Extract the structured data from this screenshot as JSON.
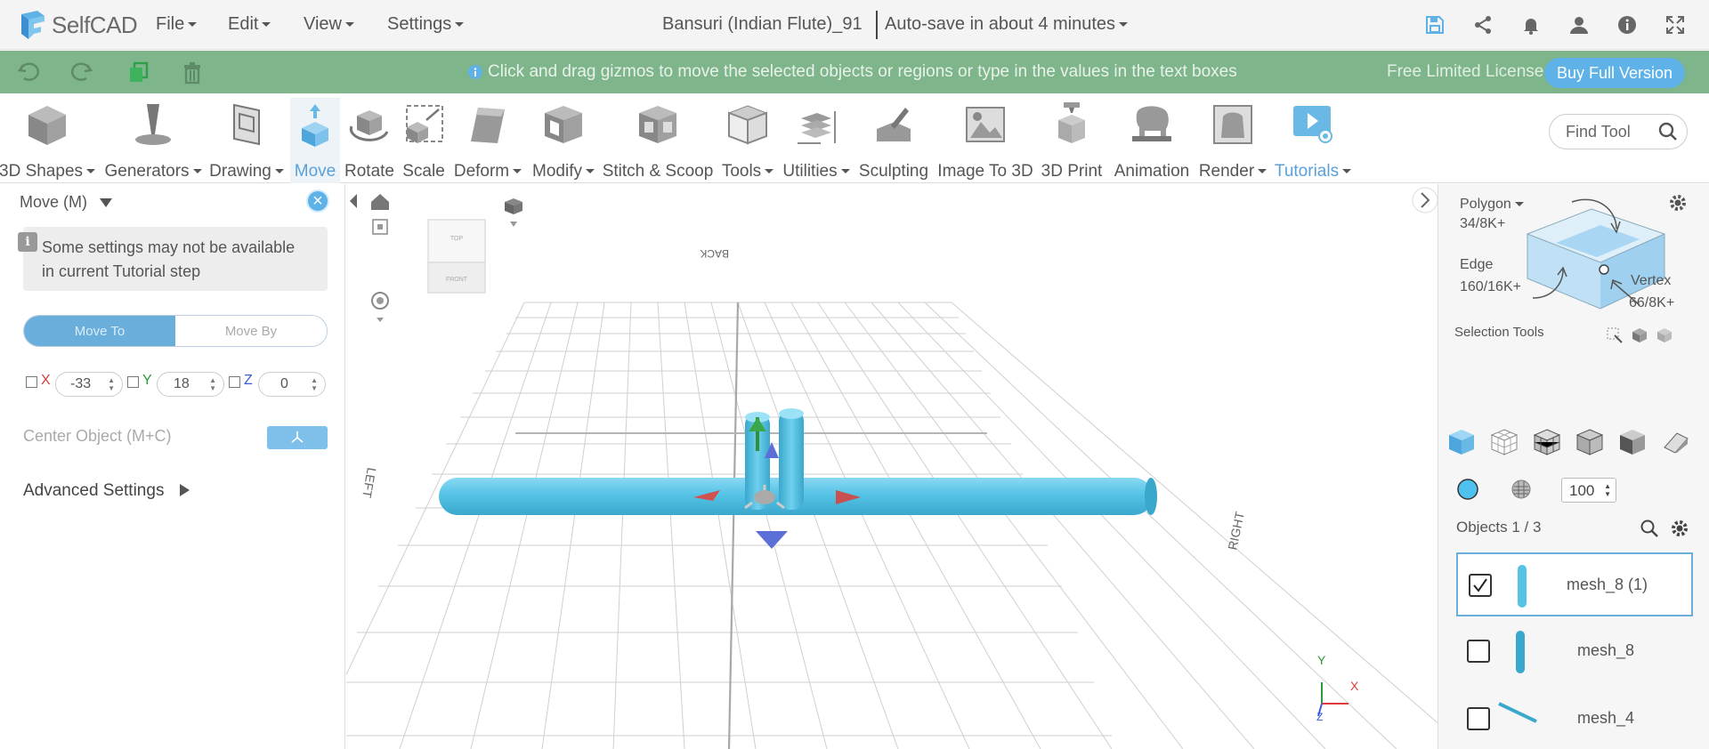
{
  "app": {
    "name": "SelfCAD"
  },
  "menus": [
    "File",
    "Edit",
    "View",
    "Settings"
  ],
  "document": {
    "title": "Bansuri (Indian Flute)_91",
    "autosave": "Auto-save in about 4 minutes"
  },
  "notice": {
    "hint": "Click and drag gizmos to move the selected objects or regions or type in the values in the text boxes",
    "license": "Free Limited License",
    "buy_label": "Buy Full Version"
  },
  "toolbar": {
    "items": [
      {
        "label": "3D Shapes",
        "dropdown": true
      },
      {
        "label": "Generators",
        "dropdown": true
      },
      {
        "label": "Drawing",
        "dropdown": true
      },
      {
        "label": "Move",
        "active": true
      },
      {
        "label": "Rotate"
      },
      {
        "label": "Scale"
      },
      {
        "label": "Deform",
        "dropdown": true
      },
      {
        "label": "Modify",
        "dropdown": true
      },
      {
        "label": "Stitch & Scoop"
      },
      {
        "label": "Tools",
        "dropdown": true
      },
      {
        "label": "Utilities",
        "dropdown": true
      },
      {
        "label": "Sculpting"
      },
      {
        "label": "Image To 3D"
      },
      {
        "label": "3D Print"
      },
      {
        "label": "Animation"
      },
      {
        "label": "Render",
        "dropdown": true
      },
      {
        "label": "Tutorials",
        "dropdown": true
      }
    ],
    "find_tool_placeholder": "Find Tool"
  },
  "left_panel": {
    "title": "Move (M)",
    "info": "Some settings may not be available in current Tutorial step",
    "mode_tabs": [
      "Move To",
      "Move By"
    ],
    "coords": {
      "x_label": "X",
      "y_label": "Y",
      "z_label": "Z",
      "x": "-33",
      "y": "18",
      "z": "0"
    },
    "center_object": "Center Object (M+C)",
    "advanced": "Advanced Settings"
  },
  "viewport": {
    "cube_labels": {
      "top": "TOP",
      "front": "FRONT"
    },
    "grid_labels": {
      "back": "BACK",
      "left": "LEFT",
      "right": "RIGHT"
    },
    "axis_labels": {
      "y": "Y",
      "x": "X",
      "z": "Z"
    }
  },
  "right_panel": {
    "polygon": {
      "label": "Polygon",
      "count": "34/8K+"
    },
    "edge": {
      "label": "Edge",
      "count": "160/16K+"
    },
    "vertex": {
      "label": "Vertex",
      "count": "66/8K+"
    },
    "selection_tools": "Selection Tools",
    "opacity": "100",
    "objects_header": "Objects 1 / 3",
    "objects": [
      {
        "name": "mesh_8 (1)",
        "checked": true
      },
      {
        "name": "mesh_8",
        "checked": false
      },
      {
        "name": "mesh_4",
        "checked": false
      }
    ]
  },
  "colors": {
    "accent": "#5fb2e8",
    "green_bar": "#7fb58a",
    "mesh": "#55c3e6"
  }
}
